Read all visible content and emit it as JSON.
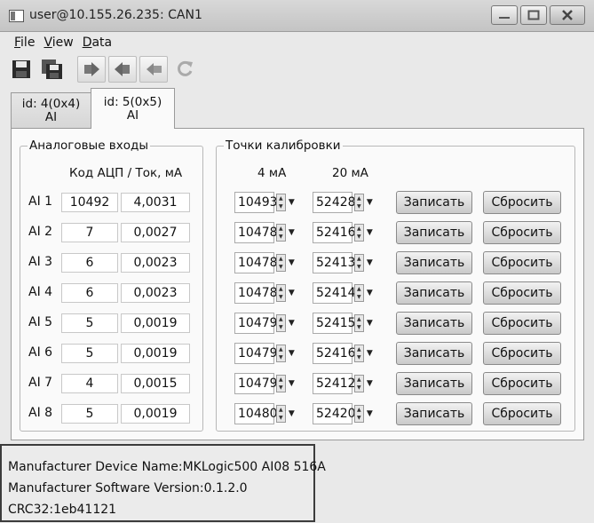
{
  "window": {
    "title": "user@10.155.26.235: CAN1"
  },
  "menu": [
    {
      "label": "File",
      "accel": "F",
      "rest": "ile"
    },
    {
      "label": "View",
      "accel": "V",
      "rest": "iew"
    },
    {
      "label": "Data",
      "accel": "D",
      "rest": "ata"
    }
  ],
  "toolbar": [
    "save-icon",
    "save-all-icon",
    "arrow-right-icon",
    "arrow-left-icon",
    "arrow-back-icon",
    "refresh-icon"
  ],
  "tabs": [
    {
      "line1": "id: 4(0x4)",
      "line2": "AI",
      "active": false
    },
    {
      "line1": "id: 5(0x5)",
      "line2": "AI",
      "active": true
    }
  ],
  "analog": {
    "title": "Аналоговые входы",
    "header": "Код АЦП / Ток, мА"
  },
  "calibration": {
    "title": "Точки калибровки",
    "col1": "4 мА",
    "col2": "20 мА",
    "write_label": "Записать",
    "reset_label": "Сбросить"
  },
  "rows": [
    {
      "label": "AI 1",
      "adc": "10492",
      "current": "4,0031",
      "p4": "10493",
      "p20": "52428"
    },
    {
      "label": "AI 2",
      "adc": "7",
      "current": "0,0027",
      "p4": "10478",
      "p20": "52416"
    },
    {
      "label": "AI 3",
      "adc": "6",
      "current": "0,0023",
      "p4": "10478",
      "p20": "52413"
    },
    {
      "label": "AI 4",
      "adc": "6",
      "current": "0,0023",
      "p4": "10478",
      "p20": "52414"
    },
    {
      "label": "AI 5",
      "adc": "5",
      "current": "0,0019",
      "p4": "10479",
      "p20": "52415"
    },
    {
      "label": "AI 6",
      "adc": "5",
      "current": "0,0019",
      "p4": "10479",
      "p20": "52416"
    },
    {
      "label": "AI 7",
      "adc": "4",
      "current": "0,0015",
      "p4": "10479",
      "p20": "52412"
    },
    {
      "label": "AI 8",
      "adc": "5",
      "current": "0,0019",
      "p4": "10480",
      "p20": "52420"
    }
  ],
  "status": {
    "device_name": "Manufacturer Device Name:MKLogic500 AI08 516A",
    "software_version": "Manufacturer Software Version:0.1.2.0",
    "crc": "CRC32:1eb41121"
  }
}
